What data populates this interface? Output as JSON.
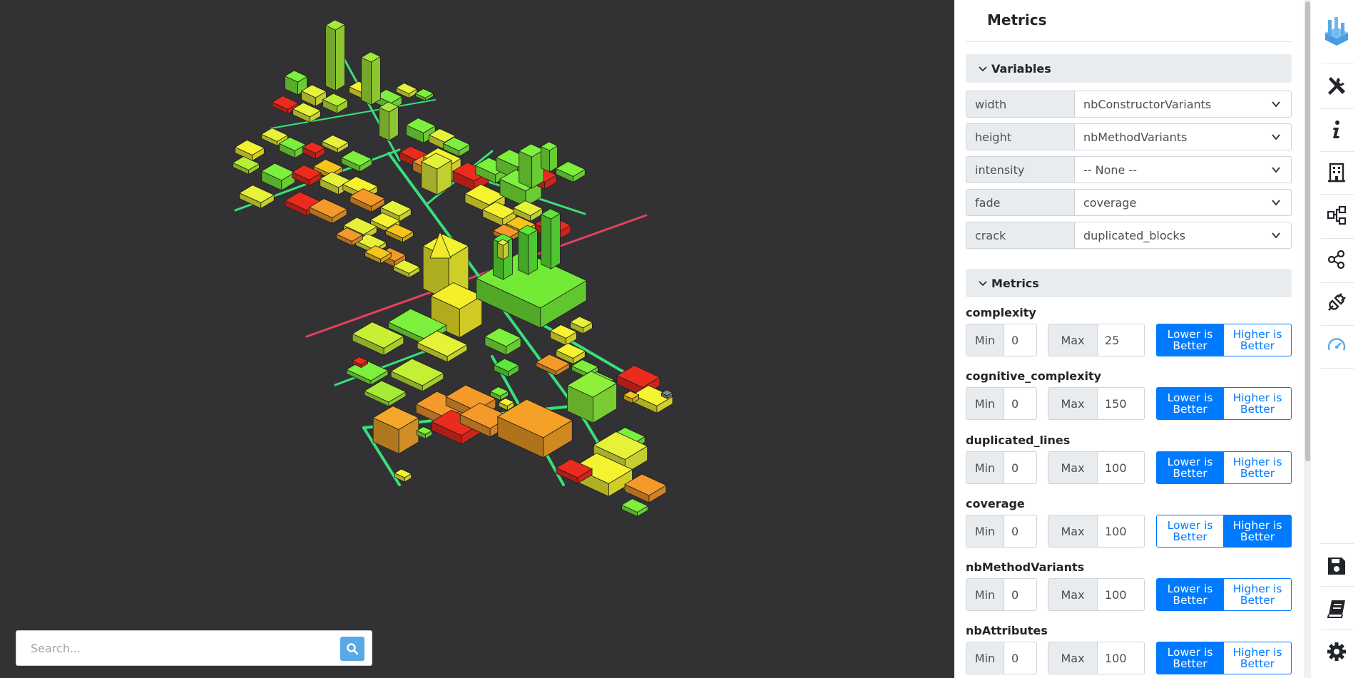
{
  "search": {
    "placeholder": "Search..."
  },
  "panel": {
    "title": "Metrics",
    "variables_section": "Variables",
    "variables": [
      {
        "label": "width",
        "value": "nbConstructorVariants"
      },
      {
        "label": "height",
        "value": "nbMethodVariants"
      },
      {
        "label": "intensity",
        "value": "-- None --"
      },
      {
        "label": "fade",
        "value": "coverage"
      },
      {
        "label": "crack",
        "value": "duplicated_blocks"
      }
    ],
    "metrics_section": "Metrics",
    "min_label": "Min",
    "max_label": "Max",
    "lower_label": "Lower is Better",
    "higher_label": "Higher is Better",
    "metrics": [
      {
        "name": "complexity",
        "min": "0",
        "max": "25",
        "better": "lower"
      },
      {
        "name": "cognitive_complexity",
        "min": "0",
        "max": "150",
        "better": "lower"
      },
      {
        "name": "duplicated_lines",
        "min": "0",
        "max": "100",
        "better": "lower"
      },
      {
        "name": "coverage",
        "min": "0",
        "max": "100",
        "better": "higher"
      },
      {
        "name": "nbMethodVariants",
        "min": "0",
        "max": "100",
        "better": "lower"
      },
      {
        "name": "nbAttributes",
        "min": "0",
        "max": "100",
        "better": "lower"
      }
    ]
  },
  "toolbar": {
    "icons": [
      "logo-icon",
      "tools-icon",
      "info-icon",
      "building-icon",
      "hierarchy-icon",
      "share-icon",
      "plug-icon",
      "gauge-icon",
      "save-icon",
      "book-icon",
      "gear-icon"
    ],
    "active": "gauge-icon"
  },
  "colors": {
    "viewport_bg": "#323234",
    "accent": "#007bff",
    "street": "#39e07a",
    "axis_line": "#e8405a",
    "logo": "#5aa9e6"
  }
}
